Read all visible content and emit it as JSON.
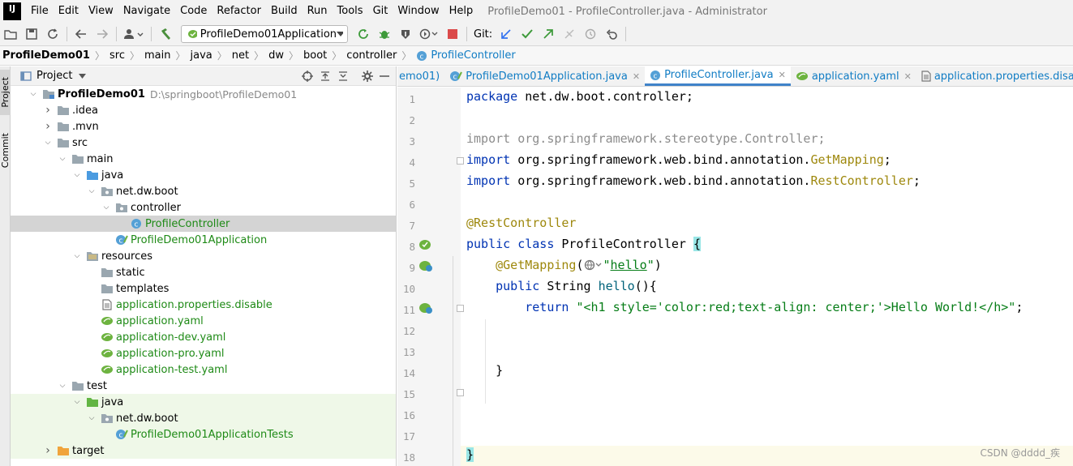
{
  "menubar": {
    "logo": "IJ",
    "items": [
      "File",
      "Edit",
      "View",
      "Navigate",
      "Code",
      "Refactor",
      "Build",
      "Run",
      "Tools",
      "Git",
      "Window",
      "Help"
    ],
    "window_title": "ProfileDemo01 - ProfileController.java - Administrator"
  },
  "toolbar": {
    "run_config": "ProfileDemo01Application",
    "git_label": "Git:"
  },
  "breadcrumbs": [
    "ProfileDemo01",
    "src",
    "main",
    "java",
    "net",
    "dw",
    "boot",
    "controller",
    "ProfileController"
  ],
  "sidebar": {
    "project_tab": "Project",
    "commit_tab": "Commit"
  },
  "project_panel": {
    "title": "Project",
    "tree": [
      {
        "label": "ProfileDemo01",
        "path": "D:\\springboot\\ProfileDemo01",
        "depth": 0,
        "icon": "module-folder-icon",
        "arrow": "open",
        "bold": true
      },
      {
        "label": ".idea",
        "depth": 1,
        "icon": "folder-icon",
        "arrow": "closed"
      },
      {
        "label": ".mvn",
        "depth": 1,
        "icon": "folder-icon",
        "arrow": "closed"
      },
      {
        "label": "src",
        "depth": 1,
        "icon": "folder-icon",
        "arrow": "open"
      },
      {
        "label": "main",
        "depth": 2,
        "icon": "folder-icon",
        "arrow": "open"
      },
      {
        "label": "java",
        "depth": 3,
        "icon": "source-folder-icon",
        "arrow": "open"
      },
      {
        "label": "net.dw.boot",
        "depth": 4,
        "icon": "package-icon",
        "arrow": "open"
      },
      {
        "label": "controller",
        "depth": 5,
        "icon": "package-icon",
        "arrow": "open"
      },
      {
        "label": "ProfileController",
        "depth": 6,
        "icon": "class-icon",
        "arrow": "none",
        "green": true,
        "selected": true
      },
      {
        "label": "ProfileDemo01Application",
        "depth": 5,
        "icon": "spring-class-icon",
        "arrow": "none",
        "green": true
      },
      {
        "label": "resources",
        "depth": 3,
        "icon": "resources-folder-icon",
        "arrow": "open"
      },
      {
        "label": "static",
        "depth": 4,
        "icon": "folder-icon",
        "arrow": "none"
      },
      {
        "label": "templates",
        "depth": 4,
        "icon": "folder-icon",
        "arrow": "none"
      },
      {
        "label": "application.properties.disable",
        "depth": 4,
        "icon": "file-icon",
        "arrow": "none",
        "green": true
      },
      {
        "label": "application.yaml",
        "depth": 4,
        "icon": "spring-yaml-icon",
        "arrow": "none",
        "green": true
      },
      {
        "label": "application-dev.yaml",
        "depth": 4,
        "icon": "spring-yaml-icon",
        "arrow": "none",
        "green": true
      },
      {
        "label": "application-pro.yaml",
        "depth": 4,
        "icon": "spring-yaml-icon",
        "arrow": "none",
        "green": true
      },
      {
        "label": "application-test.yaml",
        "depth": 4,
        "icon": "spring-yaml-icon",
        "arrow": "none",
        "green": true
      },
      {
        "label": "test",
        "depth": 2,
        "icon": "folder-icon",
        "arrow": "open"
      },
      {
        "label": "java",
        "depth": 3,
        "icon": "test-folder-icon",
        "arrow": "open",
        "test": true
      },
      {
        "label": "net.dw.boot",
        "depth": 4,
        "icon": "package-icon",
        "arrow": "open",
        "test": true
      },
      {
        "label": "ProfileDemo01ApplicationTests",
        "depth": 5,
        "icon": "spring-class-icon",
        "arrow": "none",
        "green": true,
        "test": true
      },
      {
        "label": "target",
        "depth": 1,
        "icon": "excluded-folder-icon",
        "arrow": "closed",
        "test": true
      }
    ]
  },
  "editor": {
    "tabs": [
      {
        "label": "emo01)",
        "icon": "none",
        "closable": false,
        "active": false
      },
      {
        "label": "ProfileDemo01Application.java",
        "icon": "spring-class-icon",
        "closable": true,
        "active": false
      },
      {
        "label": "ProfileController.java",
        "icon": "class-icon",
        "closable": true,
        "active": true
      },
      {
        "label": "application.yaml",
        "icon": "spring-yaml-icon",
        "closable": true,
        "active": false
      },
      {
        "label": "application.properties.disable",
        "icon": "file-icon",
        "closable": false,
        "active": false
      }
    ],
    "line_numbers": [
      "1",
      "2",
      "3",
      "4",
      "5",
      "6",
      "7",
      "8",
      "9",
      "10",
      "11",
      "12",
      "13",
      "14",
      "15",
      "16",
      "17",
      "18"
    ],
    "code": {
      "l1_kw": "package",
      "l1_rest": " net.dw.boot.controller;",
      "l3": "import org.springframework.stereotype.Controller;",
      "l4_kw": "import",
      "l4_pkg": " org.springframework.web.bind.annotation.",
      "l4_cls": "GetMapping",
      "l4_end": ";",
      "l5_kw": "import",
      "l5_pkg": " org.springframework.web.bind.annotation.",
      "l5_cls": "RestController",
      "l5_end": ";",
      "l7": "@RestController",
      "l8_kw": "public class",
      "l8_name": " ProfileController ",
      "l8_brace": "{",
      "l9_indent": "    ",
      "l9_ann": "@GetMapping",
      "l9_open": "(",
      "l9_q1": "\"",
      "l9_val": "hello",
      "l9_q2": "\"",
      "l9_close": ")",
      "l10_indent": "    ",
      "l10_kw": "public",
      "l10_type": " String ",
      "l10_fn": "hello",
      "l10_end": "(){",
      "l11_indent": "        ",
      "l11_kw": "return",
      "l11_str": " \"<h1 style='color:red;text-align: center;'>Hello World!</h>\"",
      "l11_end": ";",
      "l14": "    }",
      "l18": "}"
    }
  },
  "watermark": "CSDN @dddd_疾"
}
